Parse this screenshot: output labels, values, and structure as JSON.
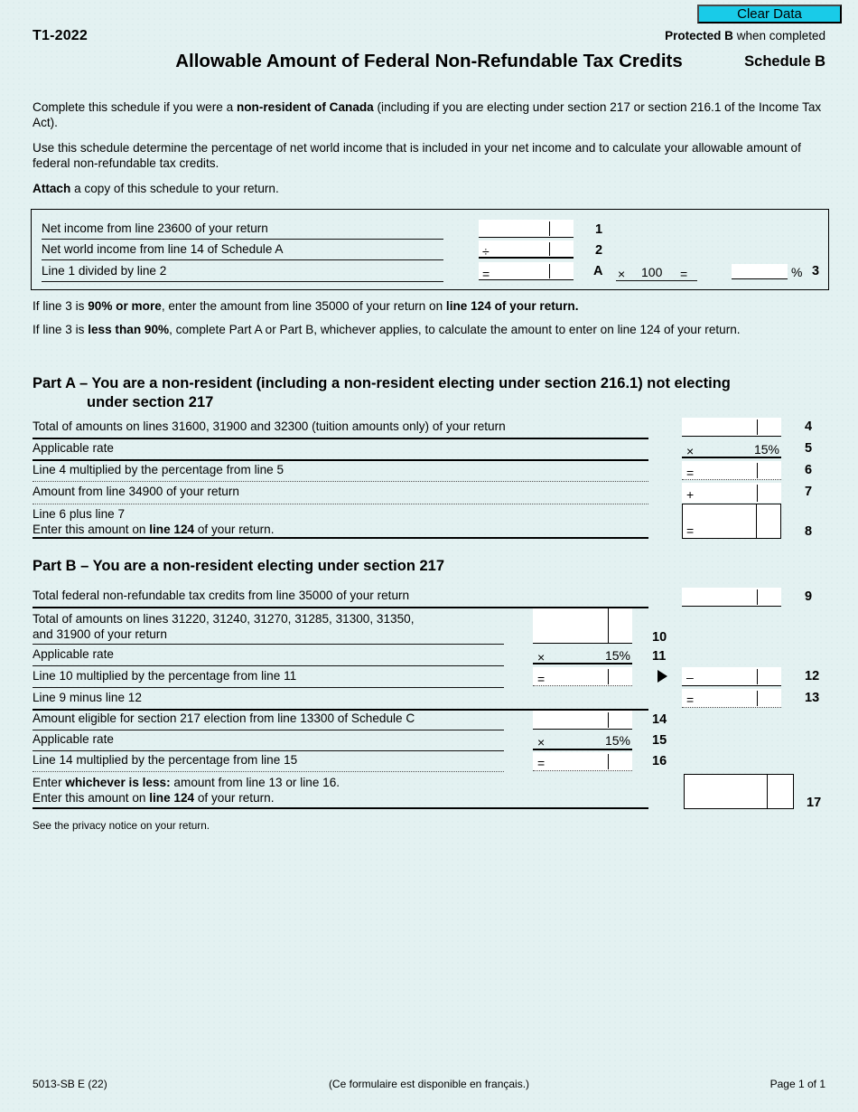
{
  "header": {
    "clear_data_label": "Clear Data",
    "form_year": "T1-2022",
    "protected_bold": "Protected B",
    "protected_rest": " when completed",
    "title": "Allowable Amount of Federal Non-Refundable Tax Credits",
    "schedule": "Schedule B"
  },
  "intro": {
    "p1_a": "Complete this schedule if you were a ",
    "p1_b": "non-resident of Canada",
    "p1_c": " (including if you are electing under section 217 or section 216.1 of the Income Tax Act).",
    "p2": "Use this schedule determine the percentage of net world income that is included in your net income and to calculate your allowable amount of federal non-refundable tax credits.",
    "p3_a": "Attach",
    "p3_b": " a copy of this schedule to your return."
  },
  "calc_box": {
    "row1_label": "Net income from line 23600 of your return",
    "row1_no": "1",
    "row2_label": "Net world income from line 14 of Schedule A",
    "row2_op": "÷",
    "row2_no": "2",
    "row3_label": "Line 1 divided by line 2",
    "row3_op": "=",
    "row3_marker": "A",
    "row3_mult_op": "×",
    "row3_mult_val": "100",
    "row3_eq": "=",
    "row3_pct_symbol": "%",
    "row3_no": "3",
    "row1_value": "",
    "row2_value": "",
    "row3_value": "",
    "row3_pct_value": ""
  },
  "notes": {
    "n1_a": "If line 3 is ",
    "n1_b": "90% or more",
    "n1_c": ", enter the amount from line 35000 of your return on ",
    "n1_d": "line 124",
    "n1_e": " of your return.",
    "n2_a": "If line 3 is ",
    "n2_b": "less than 90%",
    "n2_c": ", complete Part A or Part B, whichever applies, to calculate the amount to enter on line 124 of your return."
  },
  "part_a": {
    "heading_line1": "Part A – You are a non-resident (including a non-resident electing under section 216.1) not electing",
    "heading_line2": "under section 217",
    "rows": [
      {
        "no": "4",
        "label": "Total of amounts on lines 31600, 31900 and 32300 (tuition amounts only) of your return",
        "op": "",
        "value": ""
      },
      {
        "no": "5",
        "label": "Applicable rate",
        "op": "×",
        "value": "15%"
      },
      {
        "no": "6",
        "label": "Line 4 multiplied by the percentage from line 5",
        "op": "=",
        "value": ""
      },
      {
        "no": "7",
        "label": "Amount from line 34900 of your return",
        "op": "+",
        "value": ""
      },
      {
        "no": "8",
        "label_line1": "Line 6 plus line 7",
        "label_line2_a": "Enter this amount on ",
        "label_line2_b": "line 124",
        "label_line2_c": " of your return.",
        "op": "=",
        "value": ""
      }
    ]
  },
  "part_b": {
    "heading": "Part B – You are a non-resident electing under section 217",
    "row9": {
      "no": "9",
      "label": "Total federal non-refundable tax credits from line 35000 of your return",
      "value": ""
    },
    "row10": {
      "no": "10",
      "label_line1": "Total of amounts on lines 31220, 31240, 31270, 31285, 31300, 31350,",
      "label_line2": "and 31900 of your return",
      "value": ""
    },
    "row11": {
      "no": "11",
      "label": "Applicable rate",
      "op": "×",
      "value": "15%"
    },
    "row12": {
      "no": "12",
      "label": "Line 10 multiplied by the percentage from line 11",
      "op_left": "=",
      "value_left": "",
      "op_right": "–",
      "value_right": ""
    },
    "row13": {
      "no": "13",
      "label": "Line 9 minus line 12",
      "op": "=",
      "value": ""
    },
    "row14": {
      "no": "14",
      "label": "Amount eligible for section 217 election from line 13300 of Schedule C",
      "op": "",
      "value": ""
    },
    "row15": {
      "no": "15",
      "label": "Applicable rate",
      "op": "×",
      "value": "15%"
    },
    "row16": {
      "no": "16",
      "label": "Line 14 multiplied by the percentage from line 15",
      "op": "=",
      "value": ""
    },
    "row17": {
      "no": "17",
      "label_line1_a": "Enter ",
      "label_line1_b": "whichever is less:",
      "label_line1_c": " amount from line 13 or line 16.",
      "label_line2_a": "Enter this amount on ",
      "label_line2_b": "line 124",
      "label_line2_c": " of your return.",
      "value": ""
    }
  },
  "privacy_note": "See the privacy notice on your return.",
  "footer": {
    "left": "5013-SB E (22)",
    "center": "(Ce formulaire est disponible en français.)",
    "right": "Page 1 of 1"
  },
  "colors": {
    "page_background": "#e3f1f1",
    "clear_data_button": "#19cbe8",
    "text": "#000000"
  }
}
